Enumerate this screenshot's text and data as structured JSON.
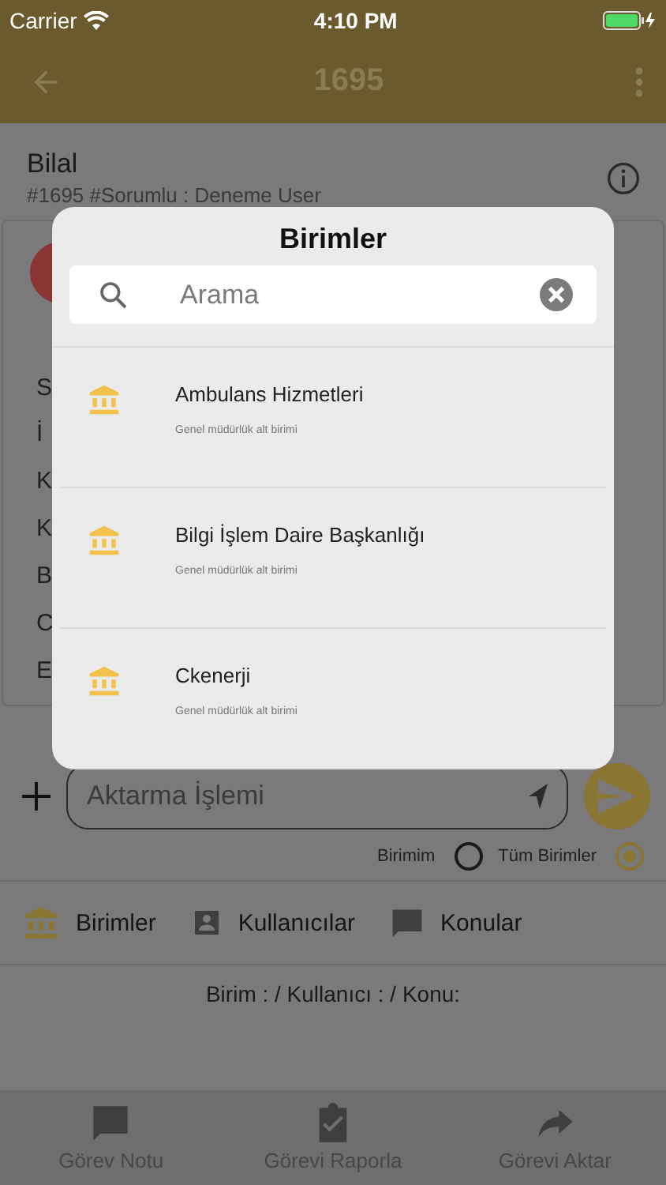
{
  "status_bar": {
    "carrier": "Carrier",
    "time": "4:10 PM"
  },
  "header": {
    "title": "1695"
  },
  "task": {
    "name": "Bilal",
    "subtitle": "#1695 #Sorumlu : Deneme User",
    "field_fragments": [
      "S",
      "İ",
      "K",
      "K",
      "B",
      "C",
      "E"
    ]
  },
  "message_input": {
    "placeholder": "Aktarma İşlemi"
  },
  "scope_options": [
    {
      "label": "Birimim",
      "selected": false
    },
    {
      "label": "Tüm Birimler",
      "selected": true
    }
  ],
  "pick_tabs": [
    {
      "label": "Birimler",
      "kind": "unit",
      "selected": true
    },
    {
      "label": "Kullanıcılar",
      "kind": "user",
      "selected": false
    },
    {
      "label": "Konular",
      "kind": "topic",
      "selected": false
    }
  ],
  "selection_summary": "Birim : / Kullanıcı :  / Konu:",
  "bottom_nav": [
    {
      "label": "Görev Notu",
      "kind": "note"
    },
    {
      "label": "Görevi Raporla",
      "kind": "report"
    },
    {
      "label": "Görevi Aktar",
      "kind": "forward"
    }
  ],
  "dialog": {
    "title": "Birimler",
    "search": {
      "placeholder": "Arama"
    },
    "items": [
      {
        "name": "Ambulans Hizmetleri",
        "subtitle": "Genel müdürlük alt birimi"
      },
      {
        "name": "Bilgi İşlem Daire Başkanlığı",
        "subtitle": "Genel müdürlük alt birimi"
      },
      {
        "name": "Ckenerji",
        "subtitle": "Genel müdürlük alt birimi"
      }
    ]
  }
}
